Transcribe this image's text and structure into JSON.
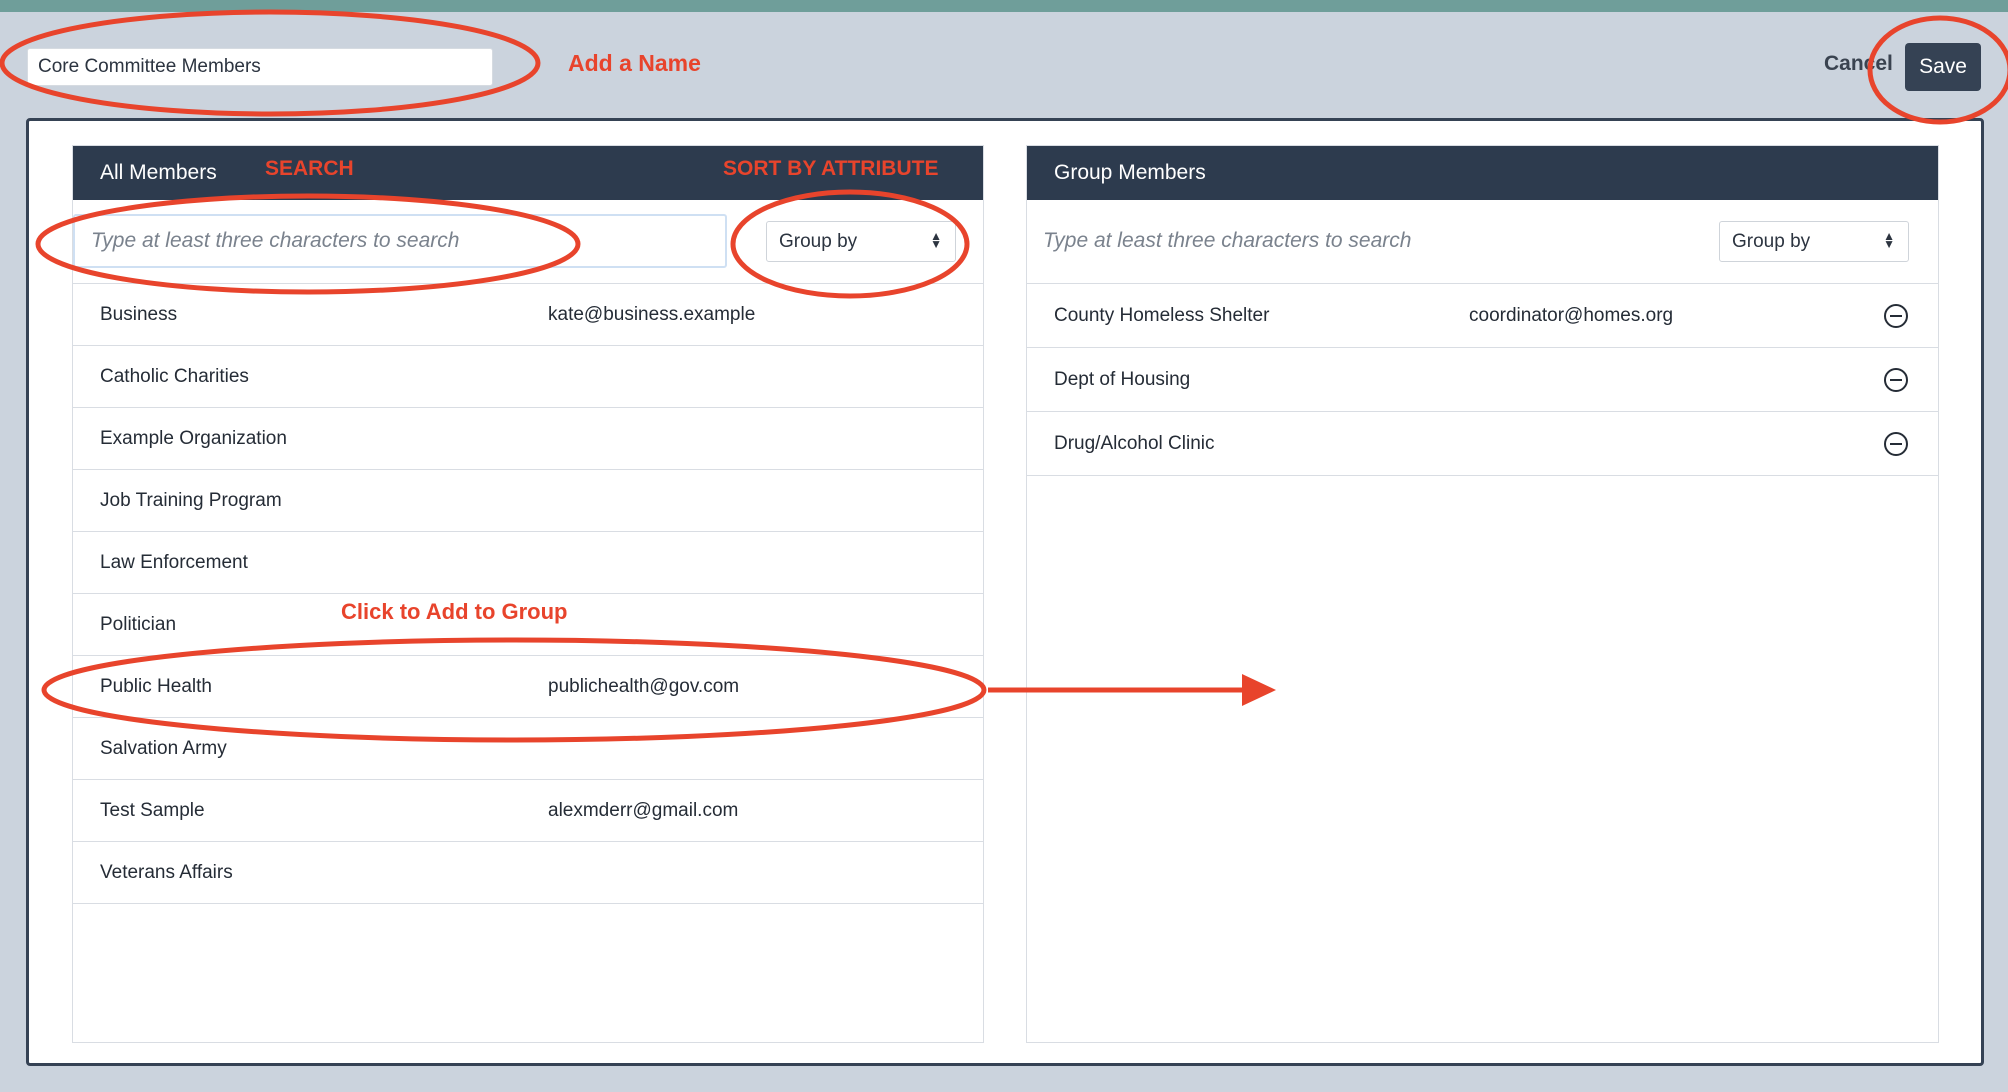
{
  "group_name": {
    "value": "Core Committee Members"
  },
  "toolbar": {
    "cancel_label": "Cancel",
    "save_label": "Save"
  },
  "all_members": {
    "title": "All Members",
    "search_placeholder": "Type at least three characters to search",
    "group_by_label": "Group by",
    "rows": [
      {
        "name": "Business",
        "email": "kate@business.example"
      },
      {
        "name": "Catholic Charities",
        "email": ""
      },
      {
        "name": "Example Organization",
        "email": ""
      },
      {
        "name": "Job Training Program",
        "email": ""
      },
      {
        "name": "Law Enforcement",
        "email": ""
      },
      {
        "name": "Politician",
        "email": ""
      },
      {
        "name": "Public Health",
        "email": "publichealth@gov.com"
      },
      {
        "name": "Salvation Army",
        "email": ""
      },
      {
        "name": "Test Sample",
        "email": "alexmderr@gmail.com"
      },
      {
        "name": "Veterans Affairs",
        "email": ""
      }
    ]
  },
  "group_members": {
    "title": "Group Members",
    "search_placeholder": "Type at least three characters to search",
    "group_by_label": "Group by",
    "rows": [
      {
        "name": "County Homeless Shelter",
        "email": "coordinator@homes.org"
      },
      {
        "name": "Dept of Housing",
        "email": ""
      },
      {
        "name": "Drug/Alcohol Clinic",
        "email": ""
      }
    ]
  },
  "annotations": {
    "add_name": "Add a Name",
    "search": "SEARCH",
    "sort_by_attribute": "SORT BY ATTRIBUTE",
    "click_to_add": "Click to Add to Group",
    "color": "#e8442c"
  },
  "colors": {
    "header_bg": "#2d3b4e",
    "save_bg": "#354254",
    "page_bg": "#cbd3dd",
    "top_strip": "#6f9e9a"
  }
}
